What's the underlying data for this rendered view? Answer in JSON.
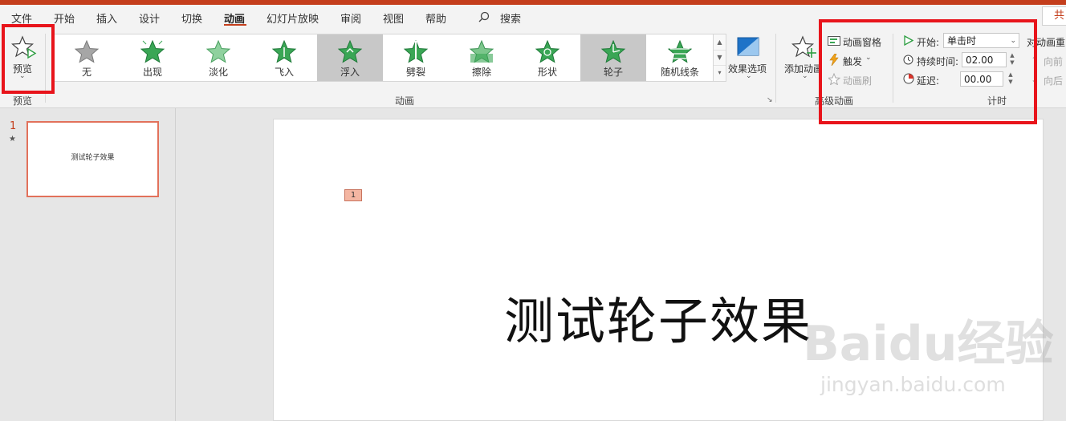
{
  "menu_tabs": [
    {
      "label": "文件",
      "active": false
    },
    {
      "label": "开始",
      "active": false
    },
    {
      "label": "插入",
      "active": false
    },
    {
      "label": "设计",
      "active": false
    },
    {
      "label": "切换",
      "active": false
    },
    {
      "label": "动画",
      "active": true
    },
    {
      "label": "幻灯片放映",
      "active": false
    },
    {
      "label": "审阅",
      "active": false
    },
    {
      "label": "视图",
      "active": false
    },
    {
      "label": "帮助",
      "active": false
    }
  ],
  "search": {
    "label": "搜索",
    "icon": "search-icon"
  },
  "share": {
    "label": "共"
  },
  "preview": {
    "label": "预览",
    "group_label": "预览",
    "icon": "preview-star-icon"
  },
  "animations": {
    "group_label": "动画",
    "items": [
      {
        "label": "无",
        "icon": "star-none-icon",
        "selected": false
      },
      {
        "label": "出现",
        "icon": "star-appear-icon",
        "selected": false
      },
      {
        "label": "淡化",
        "icon": "star-fade-icon",
        "selected": false
      },
      {
        "label": "飞入",
        "icon": "star-fly-in-icon",
        "selected": false
      },
      {
        "label": "浮入",
        "icon": "star-float-in-icon",
        "selected": true
      },
      {
        "label": "劈裂",
        "icon": "star-split-icon",
        "selected": false
      },
      {
        "label": "擦除",
        "icon": "star-wipe-icon",
        "selected": false
      },
      {
        "label": "形状",
        "icon": "star-shape-icon",
        "selected": false
      },
      {
        "label": "轮子",
        "icon": "star-wheel-icon",
        "selected": true
      },
      {
        "label": "随机线条",
        "icon": "star-random-bars-icon",
        "selected": false
      }
    ],
    "effect_options": "效果选项"
  },
  "advanced": {
    "group_label": "高级动画",
    "add_animation": "添加动画",
    "animation_pane": "动画窗格",
    "trigger": "触发",
    "animation_painter": "动画刷"
  },
  "timing": {
    "group_label": "计时",
    "start_label": "开始:",
    "start_value": "单击时",
    "duration_label": "持续时间:",
    "duration_value": "02.00",
    "delay_label": "延迟:",
    "delay_value": "00.00",
    "reorder_title": "对动画重",
    "move_earlier": "向前",
    "move_later": "向后"
  },
  "slides_pane": {
    "number": "1",
    "thumb_text": "测试轮子效果"
  },
  "slide": {
    "animation_tag": "1",
    "title": "测试轮子效果"
  },
  "watermark": {
    "logo": "Baidu经验",
    "url": "jingyan.baidu.com"
  },
  "colors": {
    "accent": "#c43e1c",
    "highlight": "#e8141b",
    "star_green": "#3aa655"
  }
}
